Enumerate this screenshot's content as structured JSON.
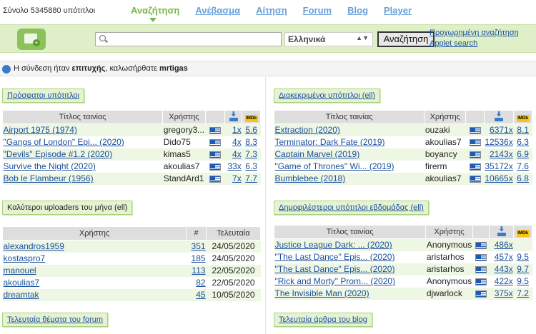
{
  "header": {
    "count_text": "Σύνολο 5345880 υπότιτλοι",
    "nav": [
      "Αναζήτηση",
      "Ανέβασμα",
      "Αίτηση",
      "Forum",
      "Blog",
      "Player"
    ]
  },
  "search": {
    "placeholder": "",
    "language": "Ελληνικά",
    "button": "Αναζήτηση",
    "advanced": "Προχωρημένη αναζήτηση",
    "applet": "Applet search"
  },
  "login": {
    "pre": "Η σύνδεση ήταν ",
    "bold1": "επιτυχής",
    "mid": ", καλωσήρθατε ",
    "user": "mrtigas"
  },
  "recent": {
    "title": "Πρόσφατοι υπότιτλοι",
    "col_title": "Τίτλος ταινίας",
    "col_user": "Χρήστης",
    "rows": [
      {
        "title": "Airport 1975 (1974)",
        "user": "gregory3...",
        "dl": "1x",
        "rating": "5.6"
      },
      {
        "title": "\"Gangs of London\" Epi... (2020)",
        "user": "Dido75",
        "dl": "4x",
        "rating": "8.3"
      },
      {
        "title": "\"Devils\" Episode #1.2 (2020)",
        "user": "kimas5",
        "dl": "4x",
        "rating": "7.3"
      },
      {
        "title": "Survive the Night (2020)",
        "user": "akoulias7",
        "dl": "33x",
        "rating": "6.3"
      },
      {
        "title": "Bob le Flambeur (1956)",
        "user": "StandArd1",
        "dl": "7x",
        "rating": "7.7"
      }
    ]
  },
  "featured": {
    "title": "Διακεκριμένοι υπότιτλοι (ell)",
    "col_title": "Τίτλος ταινίας",
    "col_user": "Χρήστης",
    "rows": [
      {
        "title": "Extraction (2020)",
        "user": "ouzaki",
        "dl": "6371x",
        "rating": "8.1"
      },
      {
        "title": "Terminator: Dark Fate (2019)",
        "user": "akoulias7",
        "dl": "12536x",
        "rating": "6.3"
      },
      {
        "title": "Captain Marvel (2019)",
        "user": "boyancy",
        "dl": "2143x",
        "rating": "6.9"
      },
      {
        "title": "\"Game of Thrones\" Wi... (2019)",
        "user": "firerm",
        "dl": "35172x",
        "rating": "7.6"
      },
      {
        "title": "Bumblebee (2018)",
        "user": "akoulias7",
        "dl": "10665x",
        "rating": "6.8"
      }
    ]
  },
  "uploaders": {
    "title": "Καλύτεροι uploaders του μήνα (ell)",
    "col_user": "Χρήστης",
    "col_num": "#",
    "col_last": "Τελευταία",
    "rows": [
      {
        "user": "alexandros1959",
        "num": "351",
        "date": "24/05/2020"
      },
      {
        "user": "kostaspro7",
        "num": "185",
        "date": "24/05/2020"
      },
      {
        "user": "manouel",
        "num": "113",
        "date": "22/05/2020"
      },
      {
        "user": "akoulias7",
        "num": "82",
        "date": "22/05/2020"
      },
      {
        "user": "dreamtak",
        "num": "45",
        "date": "10/05/2020"
      }
    ]
  },
  "popular": {
    "title": "Δημοφιλέστεροι υπότιτλοι εβδομάδας (ell)",
    "col_title": "Τίτλος ταινίας",
    "col_user": "Χρήστης",
    "rows": [
      {
        "title": "Justice League Dark: ... (2020)",
        "user": "Anonymous",
        "dl": "486x",
        "rating": ""
      },
      {
        "title": "\"The Last Dance\" Epis... (2020)",
        "user": "aristarhos",
        "dl": "457x",
        "rating": "9.5"
      },
      {
        "title": "\"The Last Dance\" Epis... (2020)",
        "user": "aristarhos",
        "dl": "443x",
        "rating": "9.7"
      },
      {
        "title": "\"Rick and Morty\" Prom... (2020)",
        "user": "Anonymous",
        "dl": "422x",
        "rating": "9.5"
      },
      {
        "title": "The Invisible Man (2020)",
        "user": "djwarlock",
        "dl": "375x",
        "rating": "7.2"
      }
    ]
  },
  "forum": {
    "title": "Τελευταία θέματα του forum"
  },
  "blog": {
    "title": "Τελευταία άρθρα του blog"
  },
  "icons": {
    "download": "download-icon",
    "imdb": "imdb-icon",
    "flag": "greek-flag-icon",
    "imdb_text": "IMDb"
  }
}
